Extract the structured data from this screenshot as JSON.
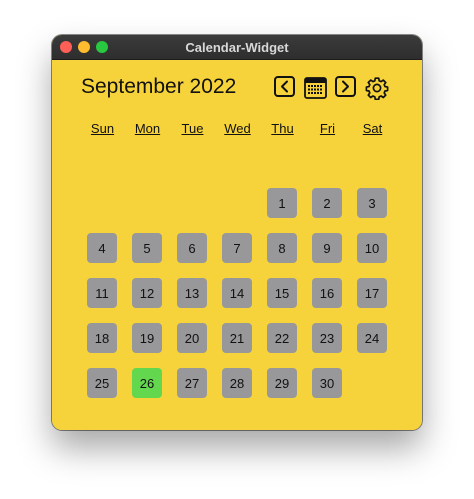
{
  "window": {
    "title": "Calendar-Widget"
  },
  "header": {
    "month_label": "September 2022",
    "prev_icon": "chevron-left-icon",
    "today_icon": "calendar-icon",
    "next_icon": "chevron-right-icon",
    "settings_icon": "gear-icon"
  },
  "weekdays": [
    "Sun",
    "Mon",
    "Tue",
    "Wed",
    "Thu",
    "Fri",
    "Sat"
  ],
  "calendar": {
    "first_weekday_index": 4,
    "days": [
      "1",
      "2",
      "3",
      "4",
      "5",
      "6",
      "7",
      "8",
      "9",
      "10",
      "11",
      "12",
      "13",
      "14",
      "15",
      "16",
      "17",
      "18",
      "19",
      "20",
      "21",
      "22",
      "23",
      "24",
      "25",
      "26",
      "27",
      "28",
      "29",
      "30"
    ],
    "highlighted_day": "26"
  },
  "colors": {
    "background": "#f7d33b",
    "day_cell": "#98979a",
    "today_cell": "#63d84f"
  }
}
